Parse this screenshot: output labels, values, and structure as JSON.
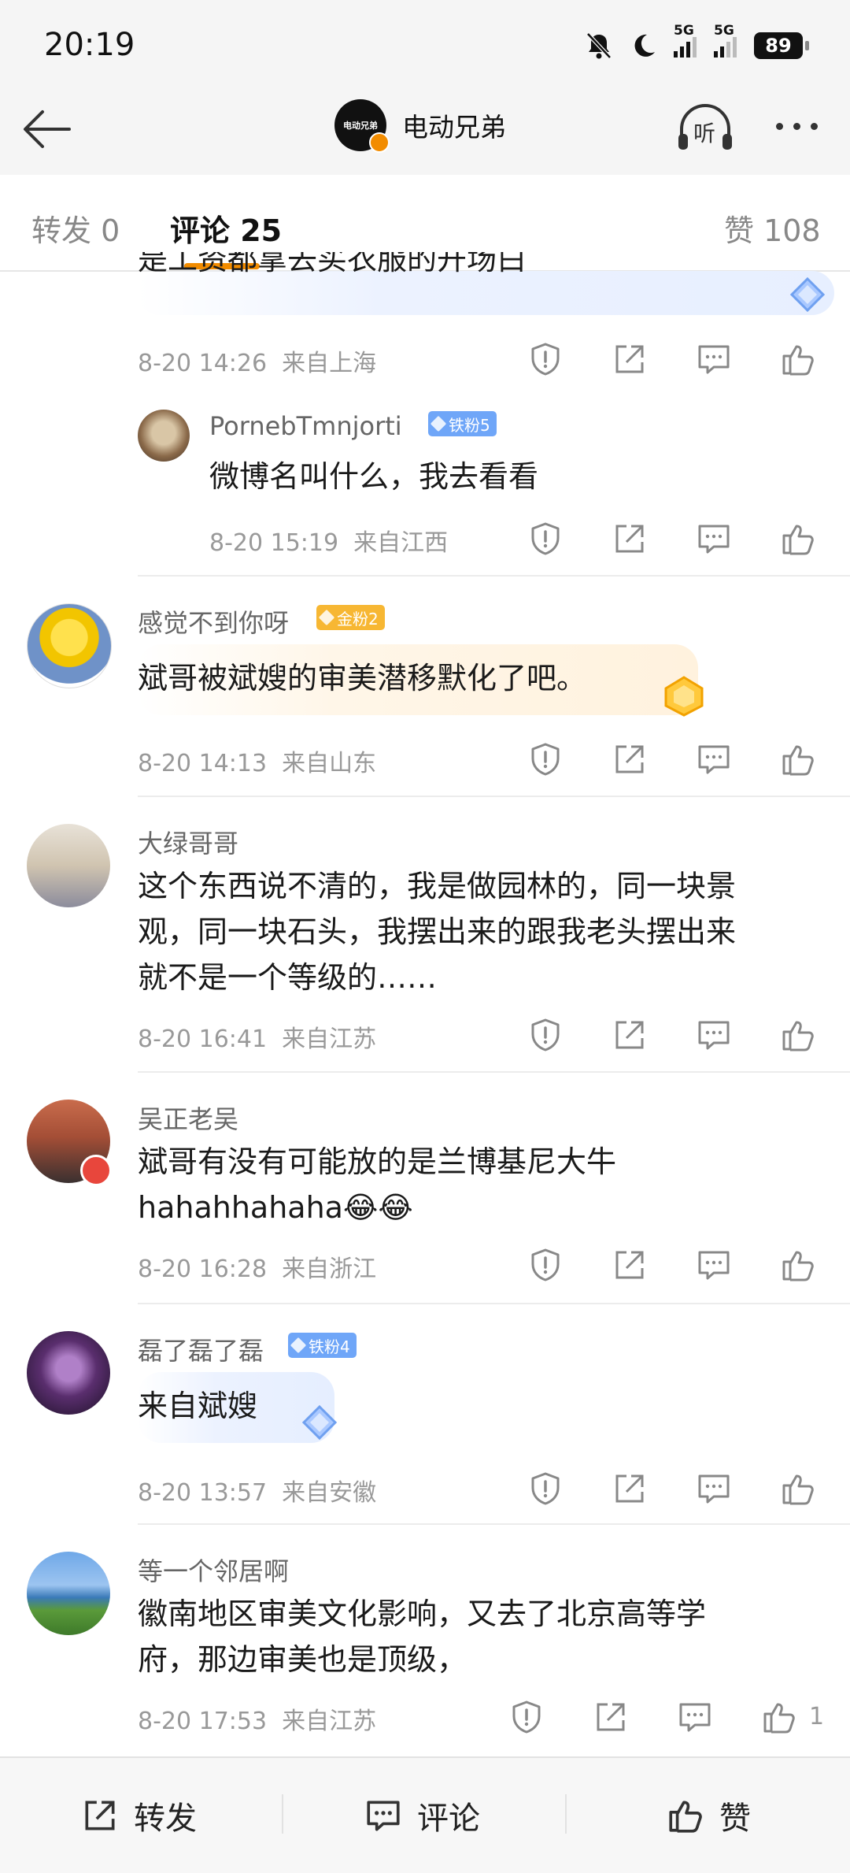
{
  "status_bar": {
    "time": "20:19",
    "network1": "5G",
    "network2": "5G",
    "battery": "89",
    "icons": [
      "bell-off-icon",
      "moon-icon",
      "signal-icon",
      "signal-icon",
      "battery-icon"
    ]
  },
  "header": {
    "title": "电动兄弟",
    "logo_text": "电动兄弟",
    "back_icon": "back-arrow-icon",
    "listen_label": "听",
    "more_icon": "more-icon"
  },
  "tabs": {
    "repost": "转发 0",
    "comments": "评论 25",
    "likes": "赞 108",
    "accent": "#f28c00"
  },
  "comments": [
    {
      "partial_text": "是工资都拿去买衣服的开场白",
      "time": "8-20 14:26",
      "location": "来自上海",
      "reply": {
        "username": "PornebTmnjorti",
        "badge": "铁粉5",
        "text": "微博名叫什么，我去看看",
        "time": "8-20 15:19",
        "location": "来自江西"
      }
    },
    {
      "username": "感觉不到你呀",
      "badge": "金粉2",
      "text": "斌哥被斌嫂的审美潜移默化了吧。",
      "time": "8-20 14:13",
      "location": "来自山东"
    },
    {
      "username": "大绿哥哥",
      "lines": [
        "这个东西说不清的，我是做园林的，同一块景",
        "观，同一块石头，我摆出来的跟我老头摆出来",
        "就不是一个等级的……"
      ],
      "time": "8-20 16:41",
      "location": "来自江苏"
    },
    {
      "username": "吴正老吴",
      "lines": [
        "斌哥有没有可能放的是兰博基尼大牛",
        "hahahhahaha😂😂"
      ],
      "time": "8-20 16:28",
      "location": "来自浙江"
    },
    {
      "username": "磊了磊了磊",
      "badge": "铁粉4",
      "text": "来自斌嫂",
      "time": "8-20 13:57",
      "location": "来自安徽"
    },
    {
      "username": "等一个邻居啊",
      "lines": [
        "徽南地区审美文化影响，又去了北京高等学",
        "府，那边审美也是顶级，"
      ],
      "time": "8-20 17:53",
      "location": "来自江苏",
      "like_count": "1"
    }
  ],
  "action_icons": [
    "report-icon",
    "share-icon",
    "comment-icon",
    "like-icon"
  ],
  "bottom_bar": {
    "repost": "转发",
    "comment": "评论",
    "like": "赞"
  }
}
